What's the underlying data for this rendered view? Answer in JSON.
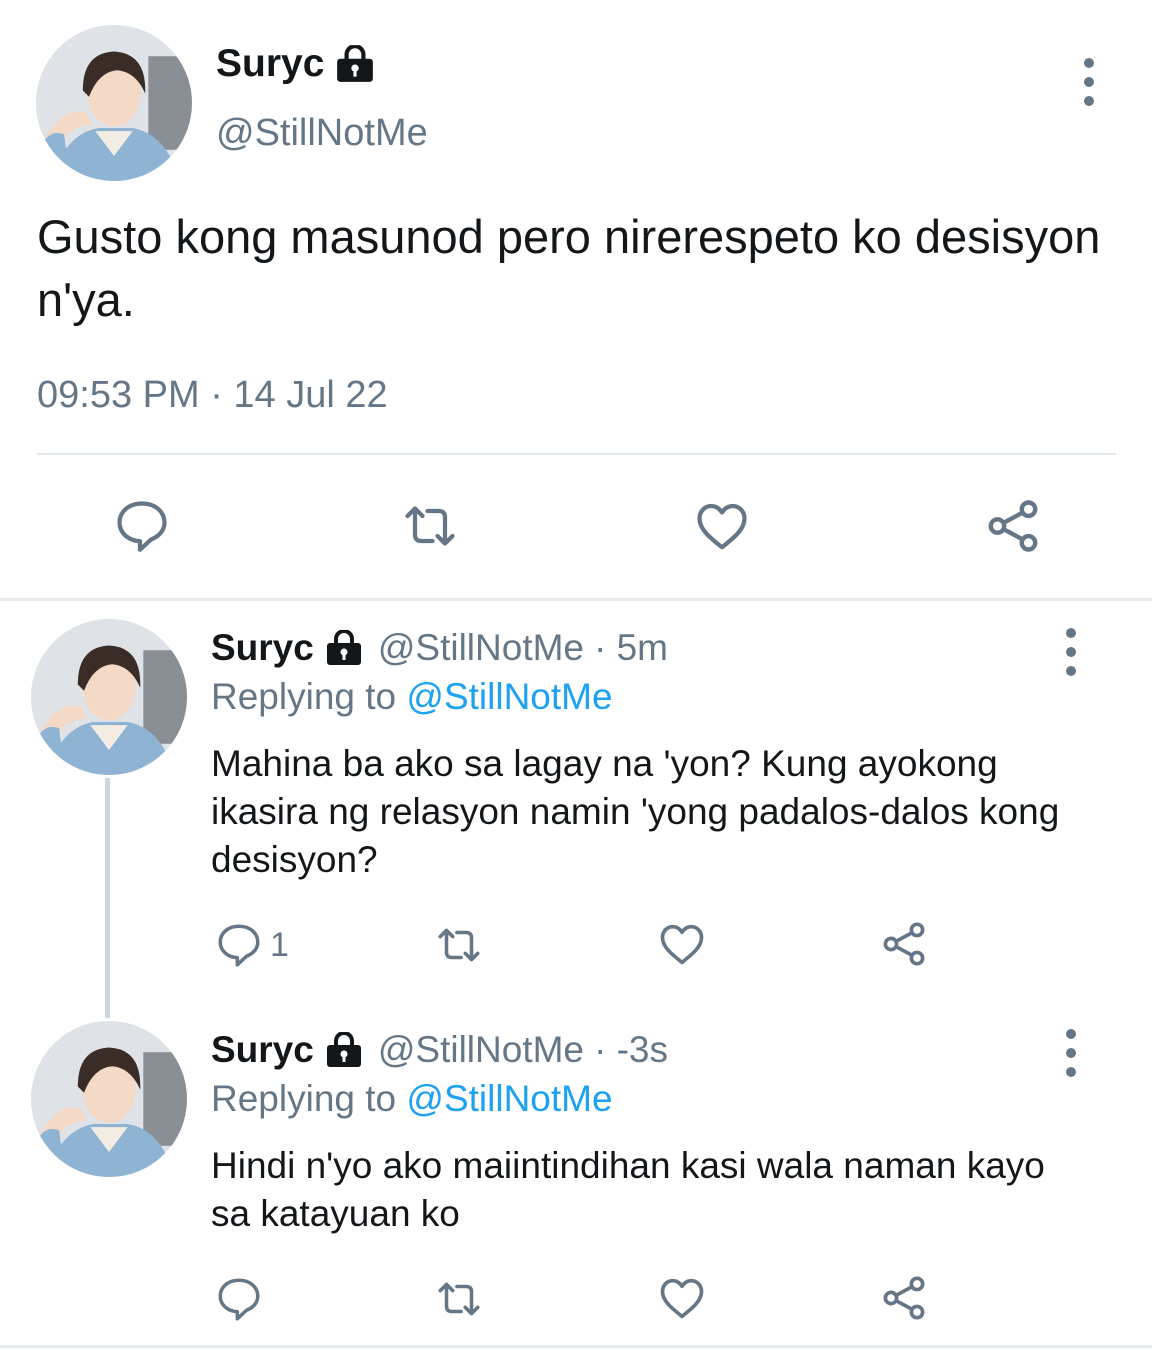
{
  "main_tweet": {
    "name": "Suryc",
    "handle": "@StillNotMe",
    "text": "Gusto kong masunod pero nirerespeto ko desisyon n'ya.",
    "timestamp": "09:53 PM · 14 Jul 22",
    "icons": [
      "lock-icon",
      "more-vertical-icon",
      "reply-icon",
      "retweet-icon",
      "like-icon",
      "share-icon"
    ]
  },
  "replies": [
    {
      "name": "Suryc",
      "handle": "@StillNotMe",
      "time": "· 5m",
      "replying_prefix": "Replying to",
      "replying_to": "@StillNotMe",
      "text": "Mahina ba ako sa lagay na 'yon? Kung ayokong ikasira ng relasyon namin 'yong padalos-dalos kong desisyon?",
      "reply_count": "1"
    },
    {
      "name": "Suryc",
      "handle": "@StillNotMe",
      "time": "· -3s",
      "replying_prefix": "Replying to",
      "replying_to": "@StillNotMe",
      "text": "Hindi n'yo ako maiintindihan kasi wala naman kayo sa katayuan ko",
      "reply_count": ""
    }
  ],
  "colors": {
    "text": "#14171a",
    "secondary": "#657786",
    "link": "#1da1f2",
    "divider": "#e1e8ed",
    "thread_line": "#ccd6dd"
  }
}
